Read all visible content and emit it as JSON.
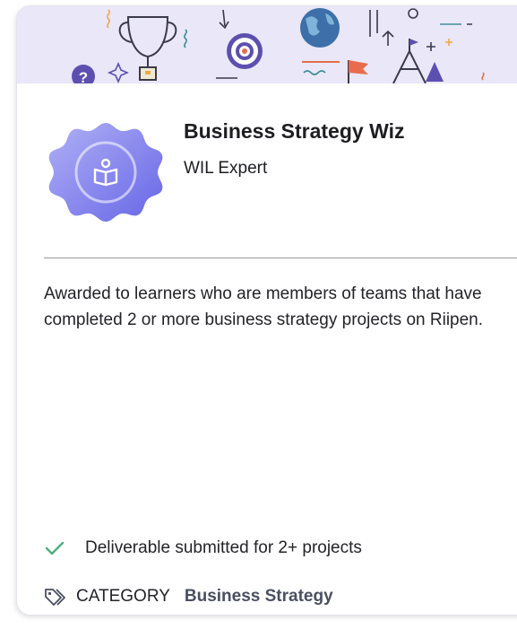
{
  "badge": {
    "title": "Business Strategy Wiz",
    "level": "WIL Expert",
    "icon": "open-book-person-icon",
    "color_start": "#a7a6f5",
    "color_end": "#6f6ee8"
  },
  "description": "Awarded to learners who are members of teams that have completed 2 or more business strategy projects on Riipen.",
  "criteria": {
    "icon": "check-icon",
    "text": "Deliverable submitted for 2+ projects",
    "color": "#4caf7d"
  },
  "category": {
    "icon": "tag-icon",
    "label": "CATEGORY",
    "value": "Business Strategy"
  },
  "banner": {
    "background": "#e9e7f8",
    "icons": [
      "trophy-icon",
      "target-icon",
      "globe-icon",
      "flag-icon",
      "mountain-icon",
      "question-icon"
    ]
  }
}
